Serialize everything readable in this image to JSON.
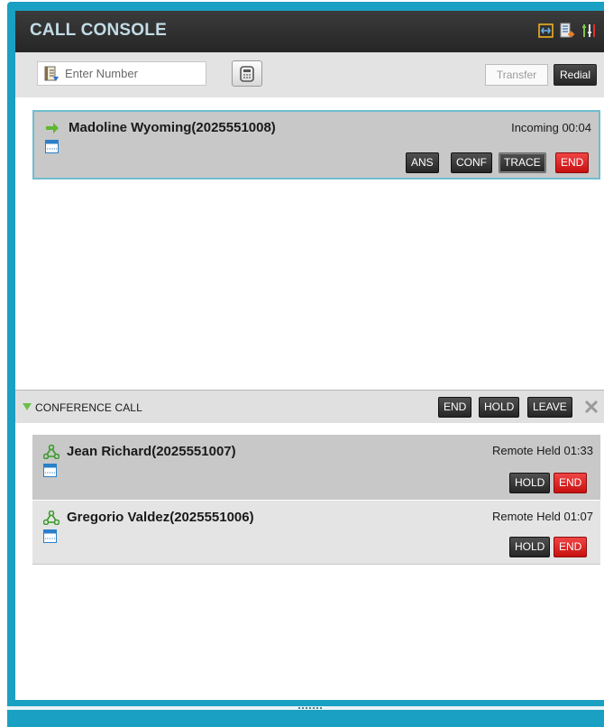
{
  "header": {
    "title": "CALL CONSOLE",
    "icons": [
      "connect-icon",
      "contacts-export-icon",
      "settings-icon"
    ]
  },
  "toolbar": {
    "number_placeholder": "Enter Number",
    "transfer_label": "Transfer",
    "redial_label": "Redial"
  },
  "active_call": {
    "name": "Madoline Wyoming(2025551008)",
    "status": "Incoming 00:04",
    "buttons": {
      "answer": "ANS",
      "conference": "CONF",
      "trace": "TRACE",
      "end": "END"
    }
  },
  "conference": {
    "title": "CONFERENCE CALL",
    "buttons": {
      "end": "END",
      "hold": "HOLD",
      "leave": "LEAVE"
    },
    "participants": [
      {
        "name": "Jean Richard(2025551007)",
        "status": "Remote Held 01:33",
        "hold_label": "HOLD",
        "end_label": "END"
      },
      {
        "name": "Gregorio Valdez(2025551006)",
        "status": "Remote Held 01:07",
        "hold_label": "HOLD",
        "end_label": "END"
      }
    ]
  },
  "colors": {
    "frame": "#1aa0c2",
    "header": "#2b2b2b",
    "header_title": "#c2dce6",
    "end_red": "#e02020",
    "active_border": "#6fbcd0"
  }
}
